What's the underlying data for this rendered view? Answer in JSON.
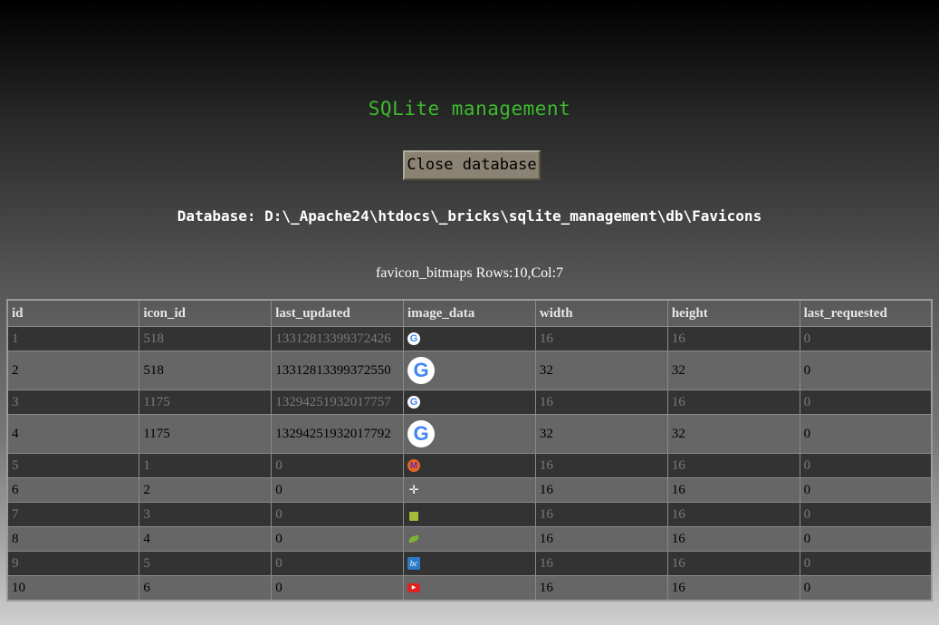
{
  "page": {
    "title": "SQLite management",
    "close_button_label": "Close database",
    "database_path": "Database: D:\\_Apache24\\htdocs\\_bricks\\sqlite_management\\db\\Favicons",
    "table_caption": "favicon_bitmaps Rows:10,Col:7"
  },
  "colors": {
    "title": "#3dbb2d",
    "button_bg": "#8a8272",
    "odd_row": "#333333",
    "even_row": "#666666"
  },
  "table": {
    "columns": [
      "id",
      "icon_id",
      "last_updated",
      "image_data",
      "width",
      "height",
      "last_requested"
    ],
    "rows": [
      {
        "id": "1",
        "icon_id": "518",
        "last_updated": "13312813399372426",
        "image_icon": "google-g-icon",
        "width": "16",
        "height": "16",
        "last_requested": "0"
      },
      {
        "id": "2",
        "icon_id": "518",
        "last_updated": "13312813399372550",
        "image_icon": "google-g-large-icon",
        "width": "32",
        "height": "32",
        "last_requested": "0"
      },
      {
        "id": "3",
        "icon_id": "1175",
        "last_updated": "13294251932017757",
        "image_icon": "google-g-icon",
        "width": "16",
        "height": "16",
        "last_requested": "0"
      },
      {
        "id": "4",
        "icon_id": "1175",
        "last_updated": "13294251932017792",
        "image_icon": "google-g-large-icon",
        "width": "32",
        "height": "32",
        "last_requested": "0"
      },
      {
        "id": "5",
        "icon_id": "1",
        "last_updated": "0",
        "image_icon": "m-logo-icon",
        "width": "16",
        "height": "16",
        "last_requested": "0"
      },
      {
        "id": "6",
        "icon_id": "2",
        "last_updated": "0",
        "image_icon": "star-cursor-icon",
        "width": "16",
        "height": "16",
        "last_requested": "0"
      },
      {
        "id": "7",
        "icon_id": "3",
        "last_updated": "0",
        "image_icon": "green-box-icon",
        "width": "16",
        "height": "16",
        "last_requested": "0"
      },
      {
        "id": "8",
        "icon_id": "4",
        "last_updated": "0",
        "image_icon": "leaf-icon",
        "width": "16",
        "height": "16",
        "last_requested": "0"
      },
      {
        "id": "9",
        "icon_id": "5",
        "last_updated": "0",
        "image_icon": "bc-logo-icon",
        "width": "16",
        "height": "16",
        "last_requested": "0"
      },
      {
        "id": "10",
        "icon_id": "6",
        "last_updated": "0",
        "image_icon": "youtube-icon",
        "width": "16",
        "height": "16",
        "last_requested": "0"
      }
    ]
  }
}
